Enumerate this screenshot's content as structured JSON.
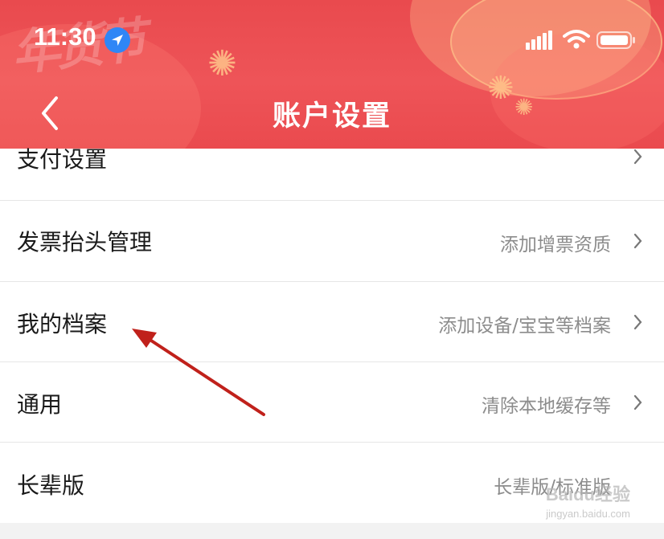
{
  "status_bar": {
    "time": "11:30",
    "icons": [
      "location-arrow-icon",
      "signal-icon",
      "wifi-icon",
      "battery-icon"
    ]
  },
  "header": {
    "title": "账户设置",
    "back_icon": "chevron-left-icon",
    "background_color": "#ea4c50",
    "decoration_text": "年货节"
  },
  "settings": {
    "rows": [
      {
        "label": "支付设置",
        "value": ""
      },
      {
        "label": "发票抬头管理",
        "value": "添加增票资质"
      },
      {
        "label": "我的档案",
        "value": "添加设备/宝宝等档案"
      },
      {
        "label": "通用",
        "value": "清除本地缓存等"
      },
      {
        "label": "长辈版",
        "value": "长辈版/标准版"
      }
    ]
  },
  "annotation": {
    "color": "#c0211b"
  },
  "watermark": {
    "brand": "Baidu经验",
    "url": "jingyan.baidu.com"
  }
}
